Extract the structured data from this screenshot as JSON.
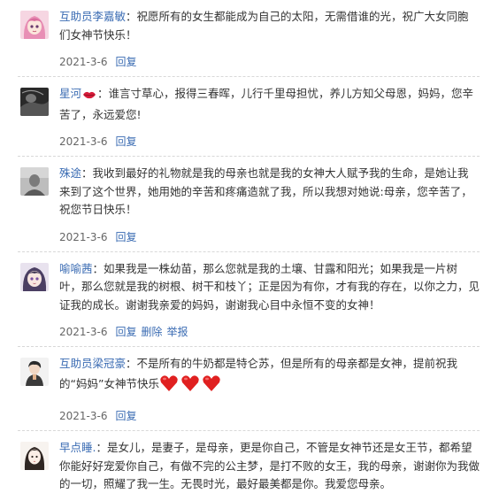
{
  "comments": [
    {
      "user": "互助员李嘉敏",
      "separator": "：",
      "text": "祝愿所有的女生都能成为自己的太阳，无需借谁的光，祝广大女同胞们女神节快乐！",
      "date": "2021-3-6",
      "actions": [
        "回复"
      ],
      "avatar": "anime-girl-pink-hair-avatar"
    },
    {
      "user": "星河",
      "user_emoji": "lips-icon",
      "separator": "：",
      "text": "谁言寸草心，报得三春晖，儿行千里母担忧，养儿方知父母恩，妈妈，您辛苦了，永远爱您!",
      "date": "2021-3-6",
      "actions": [
        "回复"
      ],
      "avatar": "dark-photo-avatar"
    },
    {
      "user": "殊途",
      "separator": "：",
      "text": "我收到最好的礼物就是我的母亲也就是我的女神大人赋予我的生命，是她让我来到了这个世界，她用她的辛苦和疼痛造就了我，所以我想对她说:母亲，您辛苦了，祝您节日快乐！",
      "date": "2021-3-6",
      "actions": [
        "回复"
      ],
      "avatar": "grey-photo-avatar"
    },
    {
      "user": "喻喻茜",
      "separator": "：",
      "text": "如果我是一株幼苗，那么您就是我的土壤、甘露和阳光；如果我是一片树叶，那么您就是我的树根、树干和枝丫；正是因为有你，才有我的存在，以你之力，见证我的成长。谢谢我亲爱的妈妈，谢谢我心目中永恒不变的女神！",
      "date": "2021-3-6",
      "actions": [
        "回复",
        "删除",
        "举报"
      ],
      "avatar": "anime-girl-purple-hair-avatar"
    },
    {
      "user": "互助员梁冠豪",
      "separator": "：",
      "text_before": "不是所有的牛奶都是特仑苏，但是所有的母亲都是女神，提前祝我的“妈妈”女神节快乐",
      "text_emoji": "three-red-hearts",
      "date": "2021-3-6",
      "actions": [
        "回复"
      ],
      "avatar": "cartoon-person-avatar"
    },
    {
      "user": "早点睡.",
      "separator": "：",
      "text": "是女儿，是妻子，是母亲，更是你自己，不管是女神节还是女王节，都希望你能好好宠爱你自己，有做不完的公主梦，是打不败的女王，我的母亲，谢谢你为我做的一切，照耀了我一生。无畏时光，最好最美都是你。我爱您母亲。",
      "date": "",
      "actions": [],
      "avatar": "sketch-girl-avatar"
    }
  ],
  "colors": {
    "link": "#3b6cb3",
    "text": "#333333",
    "meta": "#666666",
    "heart": "#e02020"
  }
}
